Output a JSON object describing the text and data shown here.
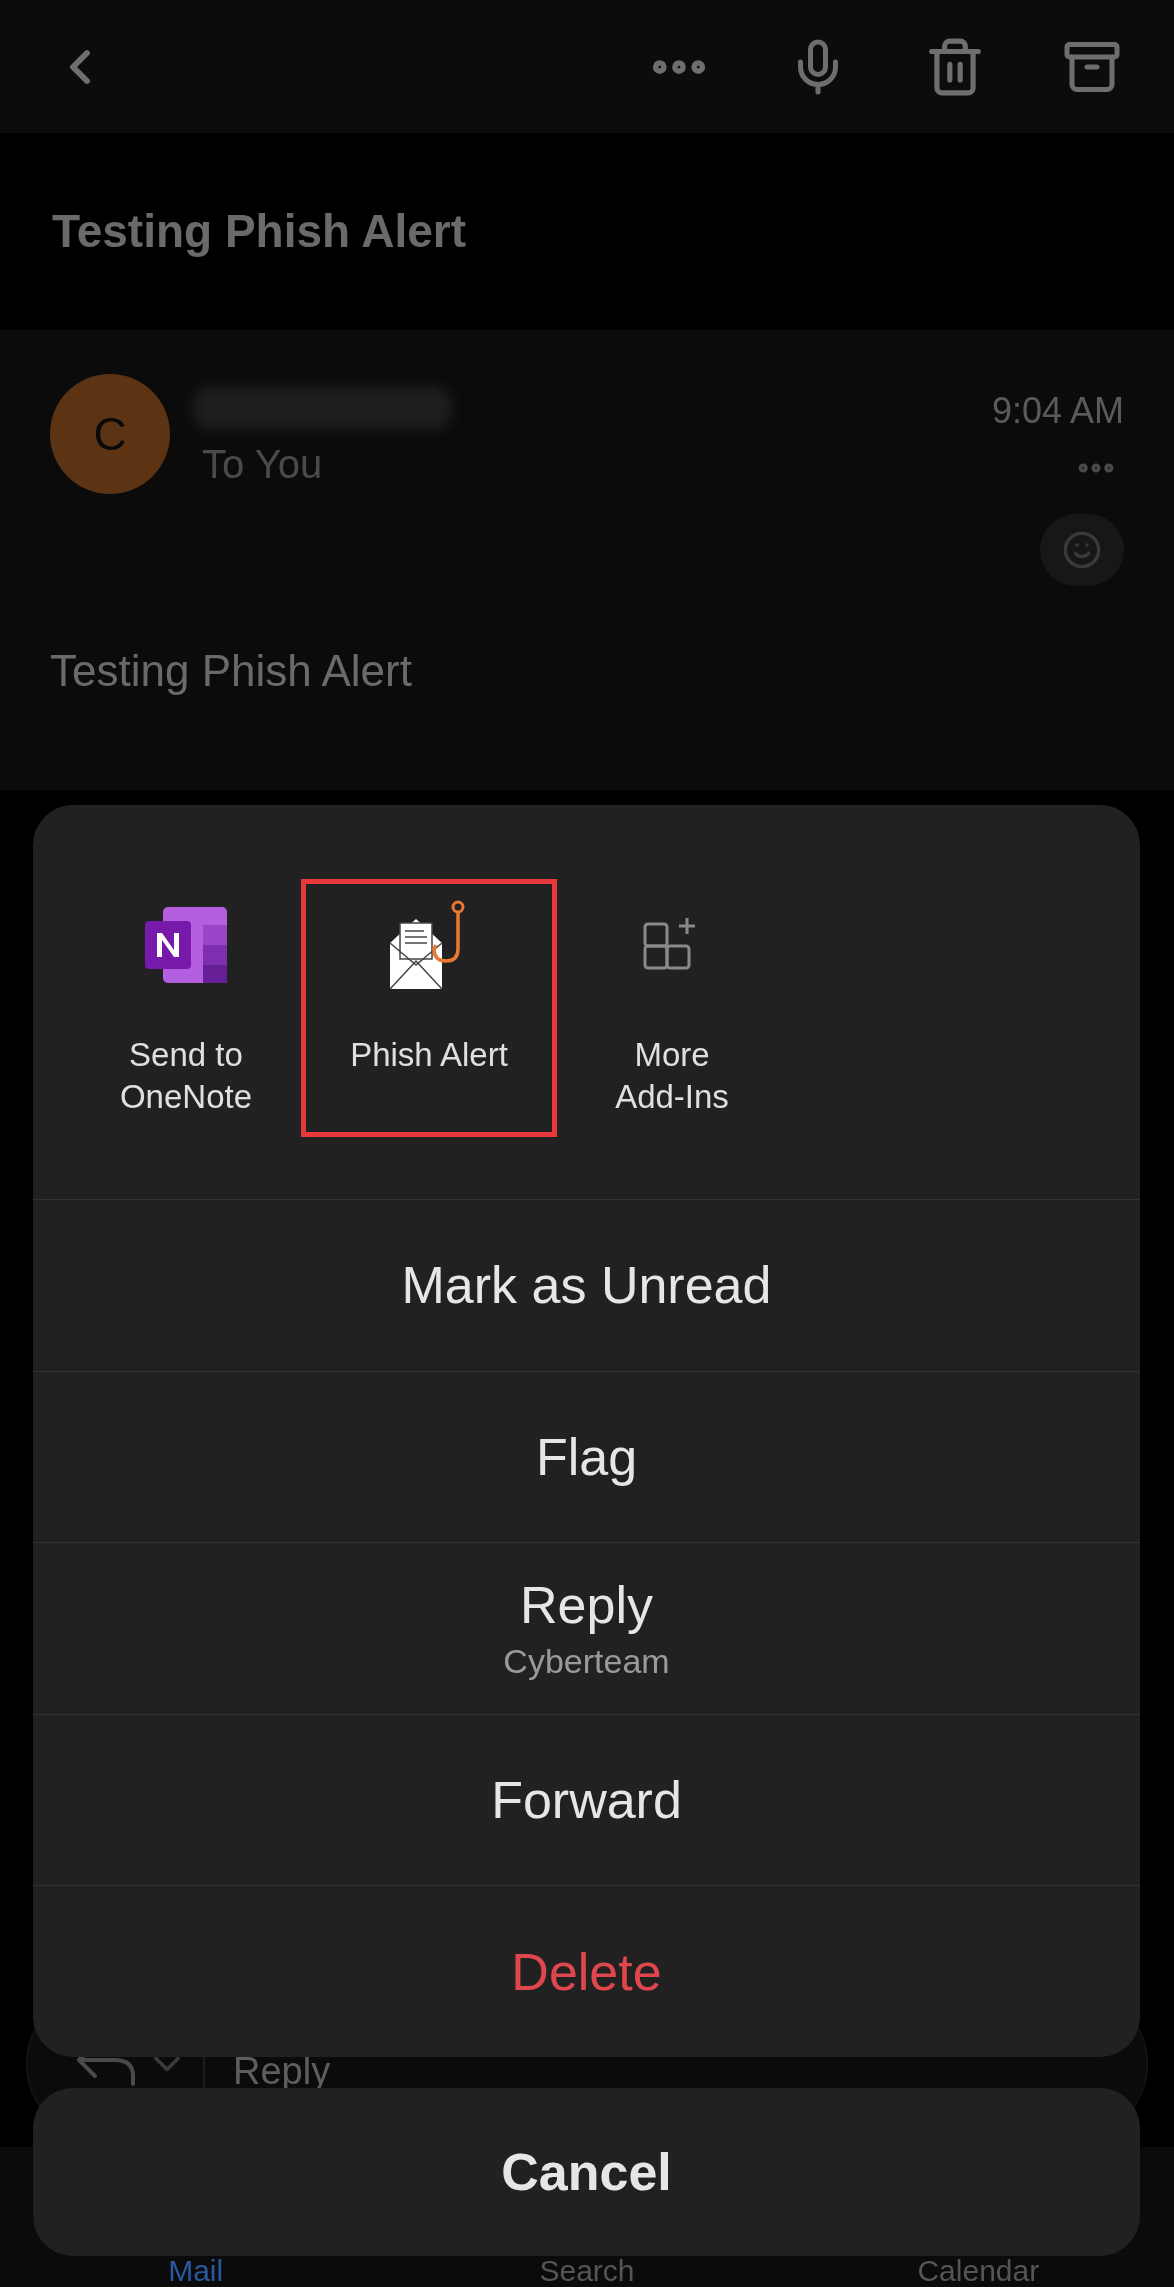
{
  "subject": "Testing Phish Alert",
  "message": {
    "avatar_initial": "C",
    "recipient": "To You",
    "time": "9:04 AM",
    "body": "Testing Phish Alert"
  },
  "reply_bar": {
    "label": "Reply"
  },
  "tab_bar": [
    {
      "label": "Mail",
      "selected": true
    },
    {
      "label": "Search",
      "selected": false
    },
    {
      "label": "Calendar",
      "selected": false
    }
  ],
  "action_sheet": {
    "add_ins": [
      {
        "kind": "onenote",
        "label": "Send to\nOneNote",
        "highlighted": false
      },
      {
        "kind": "phish",
        "label": "Phish Alert",
        "highlighted": true
      },
      {
        "kind": "more",
        "label": "More\nAdd-Ins",
        "highlighted": false
      }
    ],
    "actions": [
      {
        "label": "Mark as Unread",
        "destructive": false
      },
      {
        "label": "Flag",
        "destructive": false
      },
      {
        "label": "Reply",
        "subtitle": "Cyberteam",
        "destructive": false
      },
      {
        "label": "Forward",
        "destructive": false
      },
      {
        "label": "Delete",
        "destructive": true
      }
    ],
    "cancel": "Cancel"
  }
}
